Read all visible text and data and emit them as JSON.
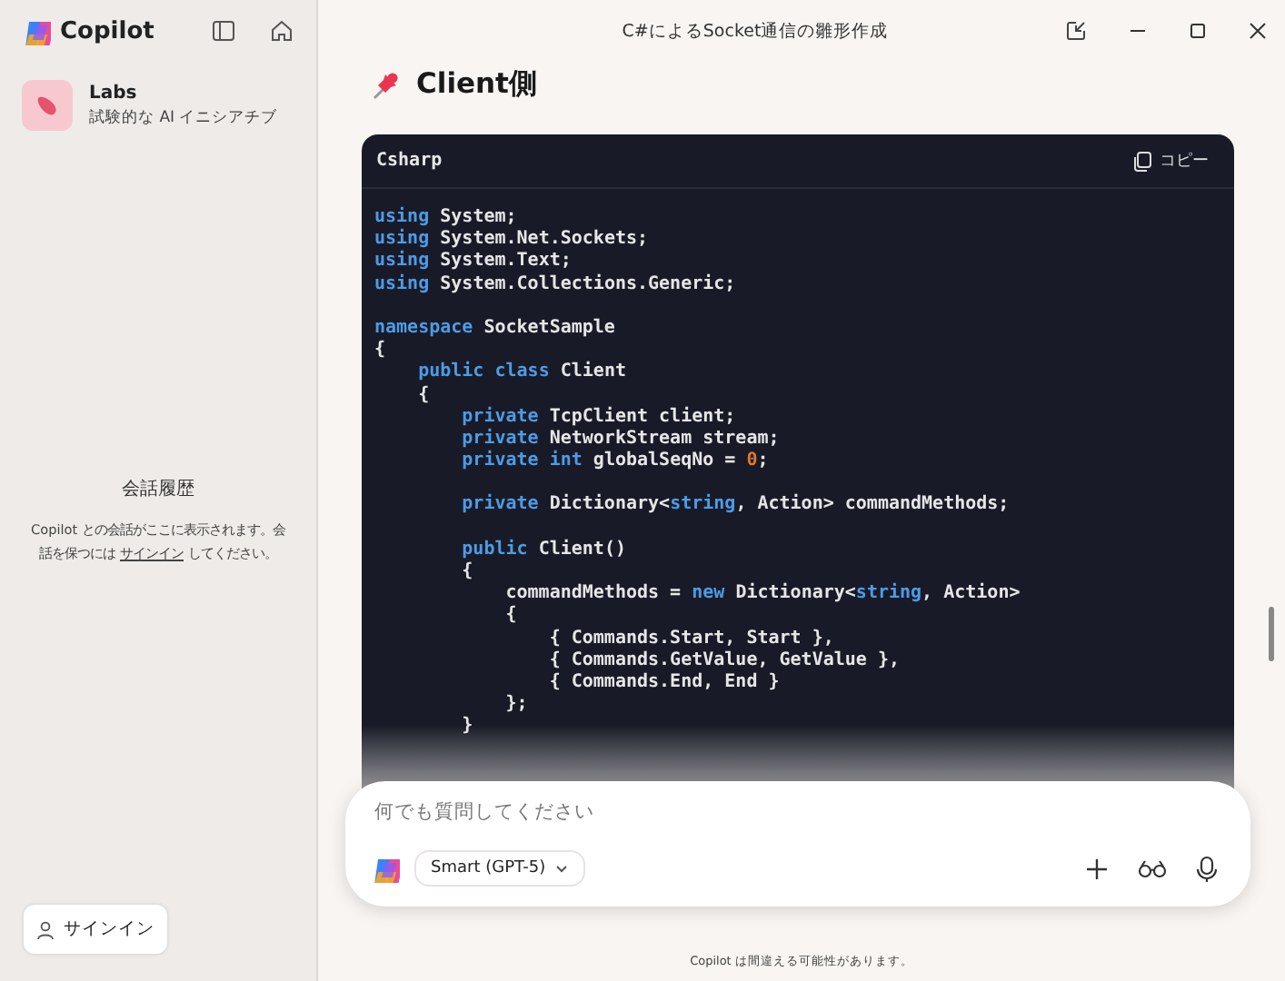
{
  "sidebar": {
    "app_name": "Copilot",
    "labs": {
      "title": "Labs",
      "subtitle": "試験的な AI イニシアチブ"
    },
    "history": {
      "title": "会話履歴",
      "text_before": "Copilot との会話がここに表示されます。会話を保つには ",
      "link": "サインイン",
      "text_after": " してください。"
    },
    "signin_button": "サインイン"
  },
  "window": {
    "title": "C#によるSocket通信の雛形作成"
  },
  "heading": "Client側",
  "code_block": {
    "language": "Csharp",
    "copy_button": "コピー",
    "lines": [
      {
        "kind": "code",
        "tokens": [
          {
            "kind": "keyword",
            "text": "using"
          },
          {
            "kind": "plain",
            "text": " System;"
          }
        ]
      },
      {
        "kind": "code",
        "tokens": [
          {
            "kind": "keyword",
            "text": "using"
          },
          {
            "kind": "plain",
            "text": " System.Net.Sockets;"
          }
        ]
      },
      {
        "kind": "code",
        "tokens": [
          {
            "kind": "keyword",
            "text": "using"
          },
          {
            "kind": "plain",
            "text": " System.Text;"
          }
        ]
      },
      {
        "kind": "code",
        "tokens": [
          {
            "kind": "keyword",
            "text": "using"
          },
          {
            "kind": "plain",
            "text": " System.Collections.Generic;"
          }
        ]
      },
      {
        "kind": "blank"
      },
      {
        "kind": "code",
        "tokens": [
          {
            "kind": "keyword",
            "text": "namespace"
          },
          {
            "kind": "plain",
            "text": " SocketSample"
          }
        ]
      },
      {
        "kind": "code",
        "tokens": [
          {
            "kind": "plain",
            "text": "{"
          }
        ]
      },
      {
        "kind": "code",
        "tokens": [
          {
            "kind": "keyword",
            "text": "    public"
          },
          {
            "kind": "keyword",
            "text": " class"
          },
          {
            "kind": "plain",
            "text": " Client"
          }
        ]
      },
      {
        "kind": "code",
        "tokens": [
          {
            "kind": "plain",
            "text": "    {"
          }
        ]
      },
      {
        "kind": "code",
        "tokens": [
          {
            "kind": "keyword",
            "text": "        private"
          },
          {
            "kind": "plain",
            "text": " TcpClient client;"
          }
        ]
      },
      {
        "kind": "code",
        "tokens": [
          {
            "kind": "keyword",
            "text": "        private"
          },
          {
            "kind": "plain",
            "text": " NetworkStream stream;"
          }
        ]
      },
      {
        "kind": "code",
        "tokens": [
          {
            "kind": "keyword",
            "text": "        private"
          },
          {
            "kind": "keyword",
            "text": " int"
          },
          {
            "kind": "plain",
            "text": " globalSeqNo = "
          },
          {
            "kind": "number",
            "text": "0"
          },
          {
            "kind": "plain",
            "text": ";"
          }
        ]
      },
      {
        "kind": "blank"
      },
      {
        "kind": "code",
        "tokens": [
          {
            "kind": "keyword",
            "text": "        private"
          },
          {
            "kind": "plain",
            "text": " Dictionary<"
          },
          {
            "kind": "keyword",
            "text": "string"
          },
          {
            "kind": "plain",
            "text": ", Action> commandMethods;"
          }
        ]
      },
      {
        "kind": "blank"
      },
      {
        "kind": "code",
        "tokens": [
          {
            "kind": "keyword",
            "text": "        public"
          },
          {
            "kind": "plain",
            "text": " Client()"
          }
        ]
      },
      {
        "kind": "code",
        "tokens": [
          {
            "kind": "plain",
            "text": "        {"
          }
        ]
      },
      {
        "kind": "code",
        "tokens": [
          {
            "kind": "plain",
            "text": "            commandMethods = "
          },
          {
            "kind": "keyword",
            "text": "new"
          },
          {
            "kind": "plain",
            "text": " Dictionary<"
          },
          {
            "kind": "keyword",
            "text": "string"
          },
          {
            "kind": "plain",
            "text": ", Action>"
          }
        ]
      },
      {
        "kind": "code",
        "tokens": [
          {
            "kind": "plain",
            "text": "            {"
          }
        ]
      },
      {
        "kind": "code",
        "tokens": [
          {
            "kind": "plain",
            "text": "                { Commands.Start, Start },"
          }
        ]
      },
      {
        "kind": "code",
        "tokens": [
          {
            "kind": "plain",
            "text": "                { Commands.GetValue, GetValue },"
          }
        ]
      },
      {
        "kind": "code",
        "tokens": [
          {
            "kind": "plain",
            "text": "                { Commands.End, End }"
          }
        ]
      },
      {
        "kind": "code",
        "tokens": [
          {
            "kind": "plain",
            "text": "            };"
          }
        ]
      },
      {
        "kind": "code",
        "tokens": [
          {
            "kind": "plain",
            "text": "        }"
          }
        ]
      }
    ]
  },
  "composer": {
    "placeholder": "何でも質問してください",
    "model_button": "Smart (GPT-5)"
  },
  "footer": "Copilot は間違える可能性があります。"
}
